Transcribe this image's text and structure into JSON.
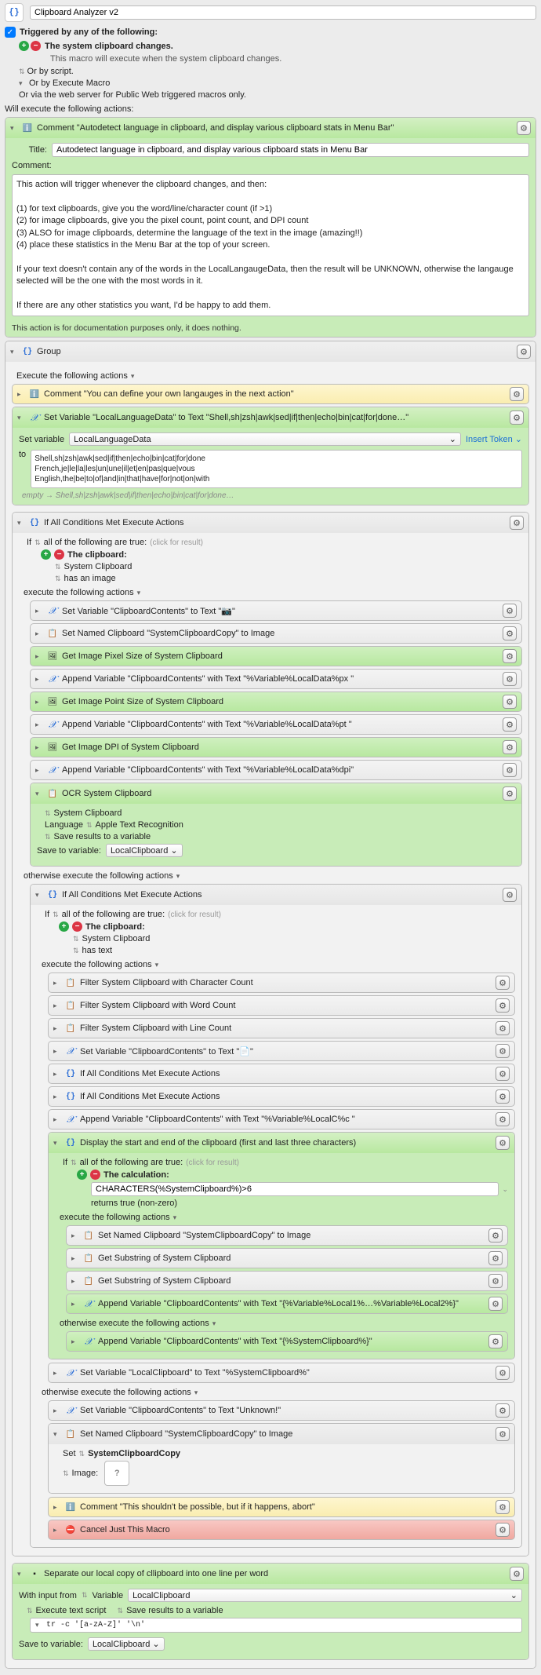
{
  "macro_name": "Clipboard Analyzer v2",
  "trigger_header": "Triggered by any of the following:",
  "trigger_line": "The system clipboard changes.",
  "trigger_desc": "This macro will execute when the system clipboard changes.",
  "or_script": "Or by script.",
  "or_exec_macro": "Or by Execute Macro",
  "or_web": "Or via the web server for Public Web triggered macros only.",
  "will_execute": "Will execute the following actions:",
  "comment1_title": "Comment \"Autodetect language in clipboard, and display various clipboard stats in Menu Bar\"",
  "comment1_title_field_label": "Title:",
  "comment1_title_value": "Autodetect language in clipboard, and display various clipboard stats in Menu Bar",
  "comment1_comment_label": "Comment:",
  "comment1_body": "This action will trigger whenever the clipboard changes, and then:\n\n(1) for text clipboards, give you the word/line/character count (if >1)\n(2) for image clipboards, give you the pixel count, point count, and DPI count\n(3) ALSO for image clipboards, determine the language of the text in the image (amazing!!)\n(4) place these statistics in the Menu Bar at the top of your screen.\n\nIf your text doesn't contain any of the words in the LocalLangaugeData, then the result will be UNKNOWN, otherwise the langauge selected will be the one with the most words in it.\n\nIf there are any other statistics you want, I'd be happy to add them.",
  "comment1_doc": "This action is for documentation purposes only, it does nothing.",
  "group_label": "Group",
  "execute_following": "Execute the following actions",
  "comment2": "Comment \"You can define your own langauges in the next action\"",
  "setvar_title": "Set Variable \"LocalLanguageData\" to Text \"Shell,sh|zsh|awk|sed|if|then|echo|bin|cat|for|done…\"",
  "setvar_label": "Set variable",
  "setvar_name": "LocalLanguageData",
  "insert_token": "Insert Token",
  "to_label": "to",
  "setvar_value": "Shell,sh|zsh|awk|sed|if|then|echo|bin|cat|for|done\nFrench,je|le|la|les|un|une|il|et|en|pas|que|vous\nEnglish,the|be|to|of|and|in|that|have|for|not|on|with",
  "empty_hint": "empty → Shell,sh|zsh|awk|sed|if|then|echo|bin|cat|for|done…",
  "if1_title": "If All Conditions Met Execute Actions",
  "if_label": "If",
  "all_of": "all of the following are true:",
  "click_result": "(click for result)",
  "the_clipboard": "The clipboard:",
  "sys_clipboard": "System Clipboard",
  "has_image": "has an image",
  "has_text": "has text",
  "exec_following": "execute the following actions",
  "otherwise_exec": "otherwise execute the following actions",
  "a1": "Set Variable \"ClipboardContents\" to Text \"📷\"",
  "a2": "Set Named Clipboard \"SystemClipboardCopy\" to Image",
  "a3": "Get Image Pixel Size of System Clipboard",
  "a4": "Append Variable \"ClipboardContents\" with Text \"%Variable%LocalData%px \"",
  "a5": "Get Image Point Size of System Clipboard",
  "a6": "Append Variable \"ClipboardContents\" with Text \"%Variable%LocalData%pt \"",
  "a7": "Get Image DPI of System Clipboard",
  "a8": "Append Variable \"ClipboardContents\" with Text \"%Variable%LocalData%dpi\"",
  "ocr_title": "OCR System Clipboard",
  "ocr_sys": "System Clipboard",
  "ocr_lang_label": "Language",
  "ocr_lang": "Apple Text Recognition",
  "save_results": "Save results to a variable",
  "save_to": "Save to variable:",
  "local_clipboard": "LocalClipboard",
  "b1": "Filter System Clipboard with Character Count",
  "b2": "Filter System Clipboard with Word Count",
  "b3": "Filter System Clipboard with Line Count",
  "b4": "Set Variable \"ClipboardContents\" to Text \"📄\"",
  "b5": "If All Conditions Met Execute Actions",
  "b6": "If All Conditions Met Execute Actions",
  "b7": "Append Variable \"ClipboardContents\" with Text \"%Variable%LocalC%c \"",
  "disp_title": "Display the start and end of the clipboard (first and last three characters)",
  "the_calc": "The calculation:",
  "calc_value": "CHARACTERS(%SystemClipboard%)>6",
  "returns_true": "returns true (non-zero)",
  "c1": "Set Named Clipboard \"SystemClipboardCopy\" to Image",
  "c2": "Get Substring of System Clipboard",
  "c3": "Get Substring of System Clipboard",
  "c4": "Append Variable \"ClipboardContents\" with Text \"{%Variable%Local1%…%Variable%Local2%}\"",
  "c5": "Append Variable \"ClipboardContents\" with Text \"{%SystemClipboard%}\"",
  "d1": "Set Variable \"LocalClipboard\" to Text \"%SystemClipboard%\"",
  "e1": "Set Variable \"ClipboardContents\" to Text \"Unknown!\"",
  "e2_title": "Set Named Clipboard \"SystemClipboardCopy\" to Image",
  "set_label": "Set",
  "set_name": "SystemClipboardCopy",
  "image_label": "Image:",
  "comment3": "Comment \"This shouldn't be possible, but if it happens, abort\"",
  "cancel": "Cancel Just This Macro",
  "sep_title": "Separate our local copy of cllipboard into one line per word",
  "with_input": "With input from",
  "variable_label": "Variable",
  "exec_script": "Execute text script",
  "tr_cmd": "tr -c '[a-zA-Z]' '\\n'"
}
